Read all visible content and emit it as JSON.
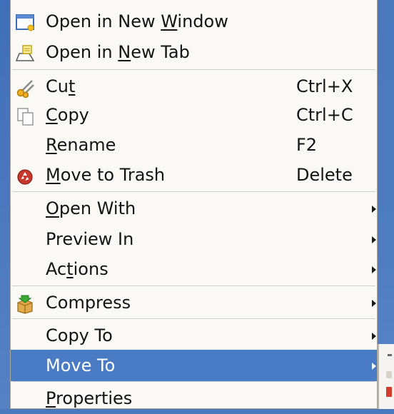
{
  "menu": {
    "items": [
      {
        "id": "open-new-window",
        "pre": "Open in New ",
        "ul": "W",
        "post": "indow",
        "shortcut": "",
        "icon": "window-icon"
      },
      {
        "id": "open-new-tab",
        "pre": "Open in ",
        "ul": "N",
        "post": "ew Tab",
        "shortcut": "",
        "icon": "tab-icon"
      },
      {
        "id": "cut",
        "pre": "Cu",
        "ul": "t",
        "post": "",
        "shortcut": "Ctrl+X",
        "icon": "scissors-icon"
      },
      {
        "id": "copy",
        "pre": "",
        "ul": "C",
        "post": "opy",
        "shortcut": "Ctrl+C",
        "icon": "copy-icon"
      },
      {
        "id": "rename",
        "pre": "",
        "ul": "R",
        "post": "ename",
        "shortcut": "F2",
        "icon": ""
      },
      {
        "id": "move-to-trash",
        "pre": "",
        "ul": "M",
        "post": "ove to Trash",
        "shortcut": "Delete",
        "icon": "trash-icon"
      },
      {
        "id": "open-with",
        "pre": "",
        "ul": "O",
        "post": "pen With",
        "shortcut": "",
        "icon": ""
      },
      {
        "id": "preview-in",
        "pre": "Preview In",
        "ul": "",
        "post": "",
        "shortcut": "",
        "icon": ""
      },
      {
        "id": "actions",
        "pre": "Ac",
        "ul": "t",
        "post": "ions",
        "shortcut": "",
        "icon": ""
      },
      {
        "id": "compress",
        "pre": "Compress",
        "ul": "",
        "post": "",
        "shortcut": "",
        "icon": "compress-icon"
      },
      {
        "id": "copy-to",
        "pre": "Copy To",
        "ul": "",
        "post": "",
        "shortcut": "",
        "icon": ""
      },
      {
        "id": "move-to",
        "pre": "Move To",
        "ul": "",
        "post": "",
        "shortcut": "",
        "icon": ""
      },
      {
        "id": "properties",
        "pre": "",
        "ul": "P",
        "post": "roperties",
        "shortcut": "",
        "icon": ""
      }
    ],
    "highlighted_item": "Move To"
  },
  "colors": {
    "menu_background": "#fbf9f5",
    "highlight": "#4a7cc6",
    "desktop": "#4a78bd",
    "text": "#141414"
  }
}
